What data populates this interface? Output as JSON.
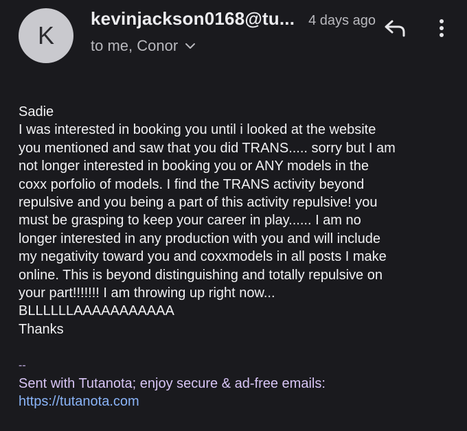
{
  "header": {
    "avatar_letter": "K",
    "sender": "kevinjackson0168@tu...",
    "time": "4 days ago",
    "recipient": "to me, Conor",
    "icons": {
      "reply": "reply-arrow-icon",
      "more": "vertical-dots-icon",
      "chevron": "chevron-down-icon"
    }
  },
  "message": {
    "lines": [
      "Sadie",
      "I was interested in booking you until i looked at the website",
      "you mentioned and saw that you did TRANS.....  sorry but I am",
      "not longer interested in booking you or ANY models in the",
      "coxx porfolio of models.  I find the TRANS activity beyond",
      "repulsive and you being a part of this activity repulsive!  you",
      "must be grasping to keep your career in play......  I am no",
      "longer interested in any production with you and will include",
      "my negativity toward you and coxxmodels in all posts I make",
      "online.  This is beyond distinguishing and totally repulsive on",
      "your part!!!!!!!  I am throwing up right now...",
      "BLLLLLLAAAAAAAAAAA",
      "Thanks"
    ]
  },
  "signature": {
    "dashes": "--",
    "text": "Sent with Tutanota; enjoy secure & ad-free emails:",
    "link": "https://tutanota.com"
  },
  "colors": {
    "background": "#1a1a1e",
    "link": "#8ab4f8",
    "signature": "#d8c5f5",
    "avatar": "#c9c9ce"
  }
}
